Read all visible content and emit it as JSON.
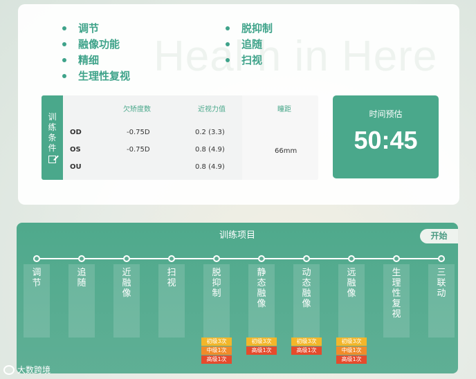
{
  "watermark": "Heal h in Here",
  "items_left": [
    "调节",
    "融像功能",
    "精细",
    "生理性复视"
  ],
  "items_right": [
    "脱抑制",
    "追随",
    "扫视"
  ],
  "train_table": {
    "label": "训练条件",
    "headers": [
      "欠矫度数",
      "近视力值",
      "瞳距"
    ],
    "rows": [
      {
        "eye": "OD",
        "undercorrection": "-0.75D",
        "acuity": "0.2 (3.3)"
      },
      {
        "eye": "OS",
        "undercorrection": "-0.75D",
        "acuity": "0.8 (4.9)"
      },
      {
        "eye": "OU",
        "undercorrection": "",
        "acuity": "0.8 (4.9)"
      }
    ],
    "pupil_distance": "66mm"
  },
  "timer": {
    "label": "时间预估",
    "value": "50:45"
  },
  "training": {
    "title": "训练项目",
    "start_label": "开始",
    "items": [
      "调节",
      "追随",
      "近融像",
      "扫视",
      "脱抑制",
      "静态融像",
      "动态融像",
      "远融像",
      "生理性复视",
      "三联动"
    ],
    "badges": [
      [
        "初级3次",
        "中级1次",
        "高级1次"
      ],
      [
        "初级3次",
        "高级1次"
      ],
      [
        "初级3次",
        "高级1次"
      ],
      [
        "初级3次",
        "中级1次",
        "高级1次"
      ]
    ]
  },
  "brand": "大数跨境",
  "colors": {
    "accent": "#4aa88b",
    "level_basic": "#f3b62a",
    "level_mid": "#f08b2a",
    "level_high": "#e54b2c"
  }
}
